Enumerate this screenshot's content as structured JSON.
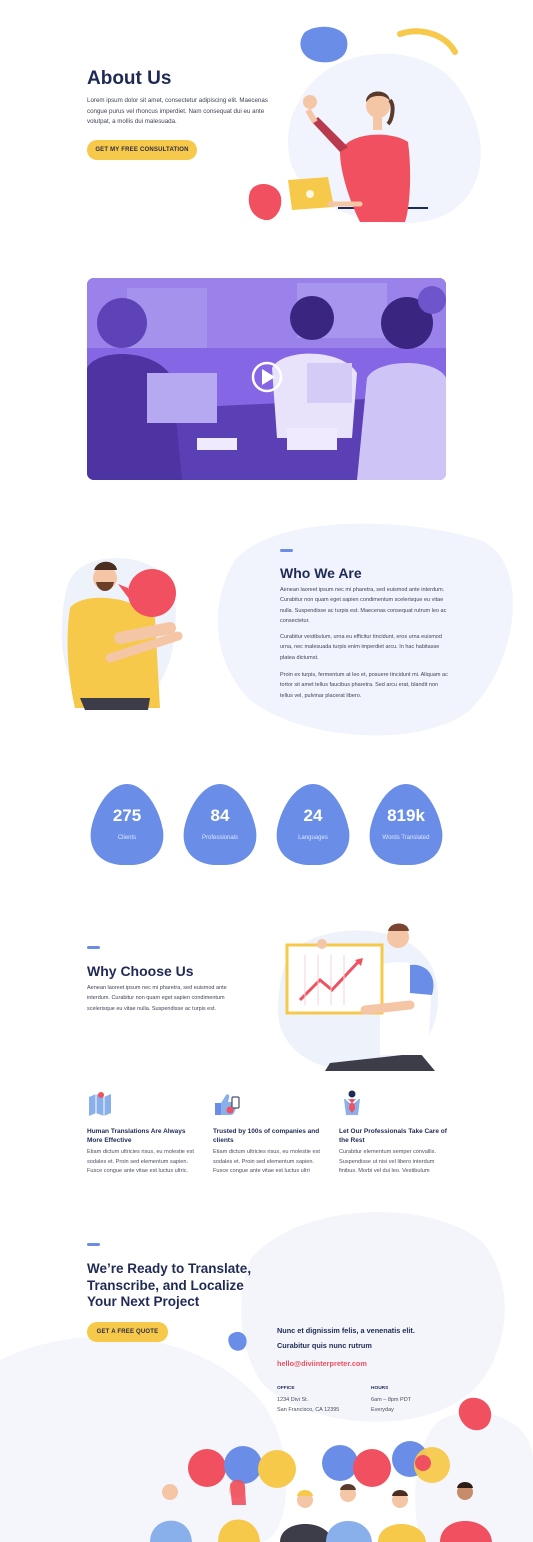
{
  "about": {
    "title": "About Us",
    "text": "Lorem ipsum dolor sit amet, consectetur adipiscing elit. Maecenas congue purus vel rhoncus imperdiet. Nam consequat dui eu ante volutpat, a mollis dui malesuada.",
    "button": "GET MY FREE CONSULTATION"
  },
  "who": {
    "title": "Who We Are",
    "p1": "Aenean laoreet ipsum nec mi pharetra, sed euismod ante interdum. Curabitur non quam eget sapien condimentum scelerisque eu vitae nulla. Suspendisse ac turpis est. Maecenas consequat rutrum leo ac consectetur.",
    "p2": "Curabitur vestibulum, urna eu efficitur tincidunt, eros urna euismod urna, nec malesuada turpis enim imperdiet arcu. In hac habitasse platea dictumst.",
    "p3": "Proin ex turpis, fermentum at leo et, posuere tincidunt mi. Aliquam ac tortor sit amet tellus faucibus pharetra. Sed arcu erat, blandit non tellus vel, pulvinar placerat libero."
  },
  "stats": [
    {
      "value": "275",
      "label": "Clients"
    },
    {
      "value": "84",
      "label": "Professionals"
    },
    {
      "value": "24",
      "label": "Languages"
    },
    {
      "value": "819k",
      "label": "Words Translated"
    }
  ],
  "why": {
    "title": "Why Choose Us",
    "text": "Aenean laoreet ipsum nec mi pharetra, sed euismod ante interdum. Curabitur non quam eget sapien condimentum scelerisque eu vitae nulla. Suspendisse ac turpis est."
  },
  "features": [
    {
      "title": "Human Translations Are Always More Effective",
      "text": "Etiam dictum ultricies risus, eu molestie est sodales et. Proin sed elementum sapien. Fusce congue ante vitae est luctus ultric.",
      "icon": "map-icon"
    },
    {
      "title": "Trusted by 100s of companies and clients",
      "text": "Etiam dictum ultricies risus, eu molestie est sodales et. Proin sed elementum sapien. Fusce congue ante vitae est luctus ultri",
      "icon": "thumbs-up-icon"
    },
    {
      "title": "Let Our Professionals Take Care of the Rest",
      "text": "Curabitur elementum semper convallis. Suspendisse ut nisi vel libero interdum finibus. Morbi vel dui leo. Vestibulum",
      "icon": "professional-tie-icon"
    }
  ],
  "cta": {
    "title_l1": "We’re Ready to Translate,",
    "title_l2": "Transcribe, and Localize",
    "title_l3": "Your Next Project",
    "button": "GET A FREE QUOTE",
    "tag_l1": "Nunc et dignissim felis, a venenatis elit.",
    "tag_l2": "Curabitur quis nunc rutrum",
    "email": "hello@diviinterpreter.com",
    "office_label": "OFFICE",
    "office_l1": "1234 Divi St.",
    "office_l2": "San Francisco, CA 12395",
    "hours_label": "HOURS",
    "hours_l1": "6am – 8pm PDT",
    "hours_l2": "Everyday"
  },
  "colors": {
    "accent": "#6a8ee8",
    "yellow": "#f7c94b",
    "red": "#f0505f",
    "navy": "#1f2a55",
    "purple": "#7b5ce0"
  }
}
